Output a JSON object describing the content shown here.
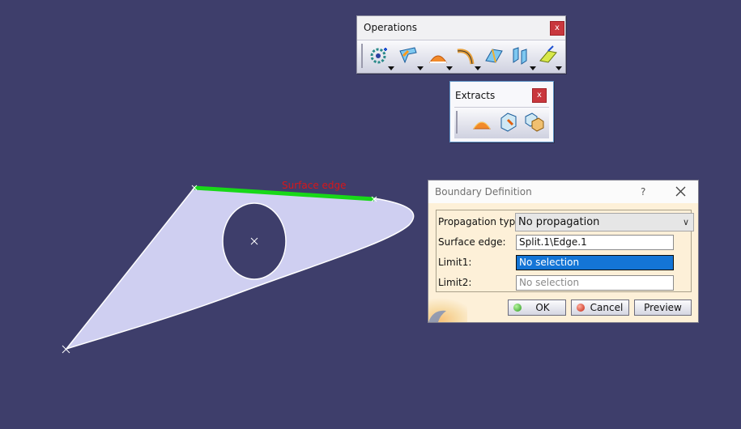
{
  "viewport": {
    "surface_label": "Surface edge",
    "colors": {
      "background": "#3e3e6b",
      "surface_fill": "#cfcff1",
      "edge_highlight": "#18d818",
      "label": "#d8161a"
    }
  },
  "operations_toolbar": {
    "title": "Operations",
    "close": "x",
    "tools": [
      "join-healing-icon",
      "untrim-icon",
      "split-icon",
      "fillet-icon",
      "extrapolate-icon",
      "transform-icon",
      "extrude-icon"
    ]
  },
  "extracts_toolbar": {
    "title": "Extracts",
    "close": "x",
    "tools": [
      "boundary-icon",
      "extract-icon",
      "multiple-extract-icon"
    ]
  },
  "dialog": {
    "title": "Boundary Definition",
    "help": "?",
    "fields": {
      "propagation_type": {
        "label": "Propagation type:",
        "value": "No propagation"
      },
      "surface_edge": {
        "label": "Surface edge:",
        "value": "Split.1\\Edge.1"
      },
      "limit1": {
        "label": "Limit1:",
        "value": "No selection"
      },
      "limit2": {
        "label": "Limit2:",
        "value": "No selection"
      }
    },
    "buttons": {
      "ok": "OK",
      "cancel": "Cancel",
      "preview": "Preview"
    }
  }
}
